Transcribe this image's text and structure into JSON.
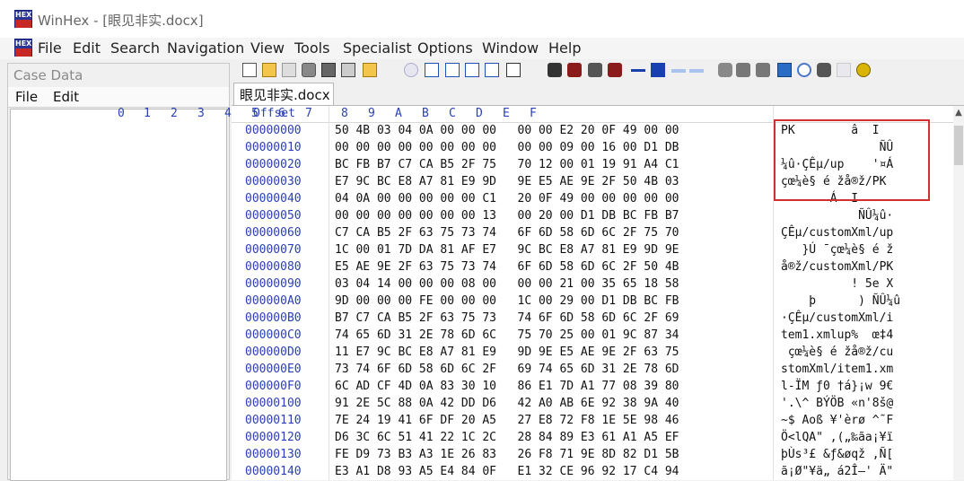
{
  "window": {
    "title": "WinHex - [眼见非实.docx]",
    "icon": "winhex-logo-icon",
    "icon_text_top": "HEX",
    "icon_text_bottom": ""
  },
  "menu": [
    "File",
    "Edit",
    "Search",
    "Navigation",
    "View",
    "Tools",
    "Specialist",
    "Options",
    "Window",
    "Help"
  ],
  "case_panel": {
    "title": "Case Data",
    "menu": [
      "File",
      "Edit"
    ]
  },
  "toolbar": {
    "icons": [
      "new-file-icon",
      "open-folder-icon",
      "save-icon",
      "save-all-icon",
      "print-icon",
      "properties-icon",
      "open-disk-icon",
      "undo-icon",
      "copy-icon",
      "cut-icon",
      "paste-icon",
      "paste-block-icon",
      "binary-icon",
      "find-text-icon",
      "find-hex-icon",
      "replace-text-icon",
      "replace-hex-icon",
      "goto-icon",
      "goto-offset-icon",
      "back-icon",
      "forward-icon",
      "disk-editor-icon",
      "ram-editor-icon",
      "disk-clone-icon",
      "calculator-icon",
      "zoom-icon",
      "snapshot-icon",
      "highlight-icon",
      "settings-icon"
    ]
  },
  "tab": {
    "label": "眼见非实.docx"
  },
  "hex": {
    "offset_label": "Offset",
    "columns": [
      "0",
      "1",
      "2",
      "3",
      "4",
      "5",
      "6",
      "7",
      "8",
      "9",
      "A",
      "B",
      "C",
      "D",
      "E",
      "F"
    ],
    "rows": [
      {
        "offset": "00000000",
        "bytes": "50 4B 03 04 0A 00 00 00   00 00 E2 20 0F 49 00 00",
        "ascii": "PK        â  I  "
      },
      {
        "offset": "00000010",
        "bytes": "00 00 00 00 00 00 00 00   00 00 09 00 16 00 D1 DB",
        "ascii": "              ÑÛ"
      },
      {
        "offset": "00000020",
        "bytes": "BC FB B7 C7 CA B5 2F 75   70 12 00 01 19 91 A4 C1",
        "ascii": "¼û·ÇÊµ/up    '¤Á"
      },
      {
        "offset": "00000030",
        "bytes": "E7 9C BC E8 A7 81 E9 9D   9E E5 AE 9E 2F 50 4B 03",
        "ascii": "çœ¼è§ é žå®ž/PK "
      },
      {
        "offset": "00000040",
        "bytes": "04 0A 00 00 00 00 00 C1   20 0F 49 00 00 00 00 00",
        "ascii": "       Á  I     "
      },
      {
        "offset": "00000050",
        "bytes": "00 00 00 00 00 00 00 13   00 20 00 D1 DB BC FB B7",
        "ascii": "           ÑÛ¼û·"
      },
      {
        "offset": "00000060",
        "bytes": "C7 CA B5 2F 63 75 73 74   6F 6D 58 6D 6C 2F 75 70",
        "ascii": "ÇÊµ/customXml/up"
      },
      {
        "offset": "00000070",
        "bytes": "1C 00 01 7D DA 81 AF E7   9C BC E8 A7 81 E9 9D 9E",
        "ascii": "   }Ú ¯çœ¼è§ é ž"
      },
      {
        "offset": "00000080",
        "bytes": "E5 AE 9E 2F 63 75 73 74   6F 6D 58 6D 6C 2F 50 4B",
        "ascii": "å®ž/customXml/PK"
      },
      {
        "offset": "00000090",
        "bytes": "03 04 14 00 00 00 08 00   00 00 21 00 35 65 18 58",
        "ascii": "          ! 5e X"
      },
      {
        "offset": "000000A0",
        "bytes": "9D 00 00 00 FE 00 00 00   1C 00 29 00 D1 DB BC FB",
        "ascii": "    þ      ) ÑÛ¼û"
      },
      {
        "offset": "000000B0",
        "bytes": "B7 C7 CA B5 2F 63 75 73   74 6F 6D 58 6D 6C 2F 69",
        "ascii": "·ÇÊµ/customXml/i"
      },
      {
        "offset": "000000C0",
        "bytes": "74 65 6D 31 2E 78 6D 6C   75 70 25 00 01 9C 87 34",
        "ascii": "tem1.xmlup%  œ‡4"
      },
      {
        "offset": "000000D0",
        "bytes": "11 E7 9C BC E8 A7 81 E9   9D 9E E5 AE 9E 2F 63 75",
        "ascii": " çœ¼è§ é žå®ž/cu"
      },
      {
        "offset": "000000E0",
        "bytes": "73 74 6F 6D 58 6D 6C 2F   69 74 65 6D 31 2E 78 6D",
        "ascii": "stomXml/item1.xm"
      },
      {
        "offset": "000000F0",
        "bytes": "6C AD CF 4D 0A 83 30 10   86 E1 7D A1 77 08 39 80",
        "ascii": "l-ÏM ƒ0 †á}¡w 9€"
      },
      {
        "offset": "00000100",
        "bytes": "91 2E 5C 88 0A 42 DD D6   42 A0 AB 6E 92 38 9A 40",
        "ascii": "'.\\^ BÝÖB «n'8š@"
      },
      {
        "offset": "00000110",
        "bytes": "7E 24 19 41 6F DF 20 A5   27 E8 72 F8 1E 5E 98 46",
        "ascii": "~$ Aoß ¥'èrø ^˜F"
      },
      {
        "offset": "00000120",
        "bytes": "D6 3C 6C 51 41 22 1C 2C   28 84 89 E3 61 A1 A5 EF",
        "ascii": "Ö<lQA\" ,(„‰ãa¡¥ï"
      },
      {
        "offset": "00000130",
        "bytes": "FE D9 73 B3 A3 1E 26 83   26 F8 71 9E 8D 82 D1 5B",
        "ascii": "þÙs³£ &ƒ&øqž ‚Ñ["
      },
      {
        "offset": "00000140",
        "bytes": "E3 A1 D8 93 A5 E4 84 0F   E1 32 CE 96 92 17 C4 94",
        "ascii": "ã¡Ø\"¥ä„ á2Î–' Ä\""
      }
    ]
  },
  "accent": {
    "offset_color": "#2a3fb8",
    "highlight_color": "#d32f2f"
  }
}
